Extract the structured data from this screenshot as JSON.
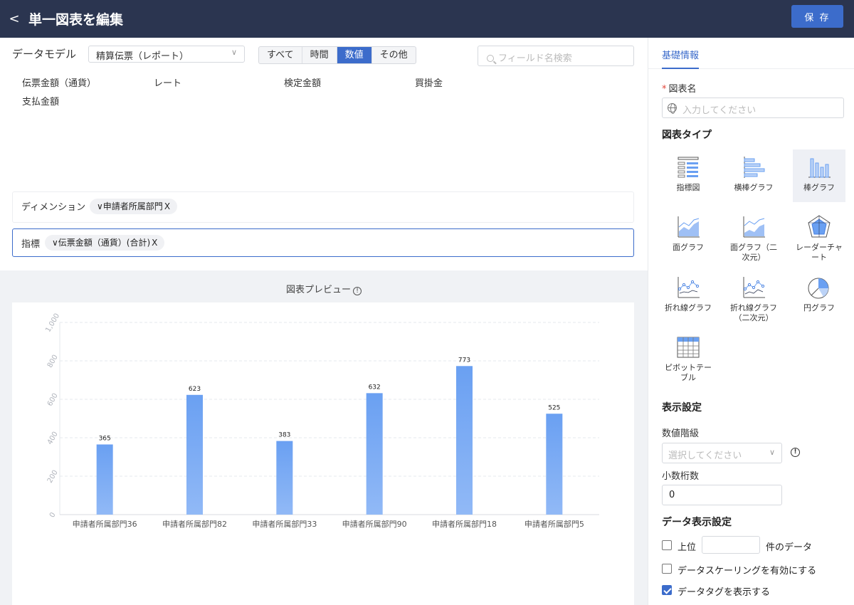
{
  "header": {
    "back_glyph": "<",
    "title": "単一図表を編集",
    "save_label": "保 存"
  },
  "data_model": {
    "label": "データモデル",
    "selected": "精算伝票（レポート）",
    "segments": [
      {
        "label": "すべて",
        "active": false
      },
      {
        "label": "時間",
        "active": false
      },
      {
        "label": "数値",
        "active": true
      },
      {
        "label": "その他",
        "active": false
      }
    ],
    "search_placeholder": "フィールド名検索"
  },
  "fields": [
    "伝票金額（通貨）",
    "レート",
    "検定金額",
    "買掛金",
    "支払金額"
  ],
  "dimension": {
    "label": "ディメンション",
    "chip": "申請者所属部門",
    "chip_prefix": "∨",
    "chip_remove": "X"
  },
  "indicator": {
    "label": "指標",
    "chip": "伝票金額（通貨）(合計)",
    "chip_prefix": "∨",
    "chip_remove": "X"
  },
  "preview": {
    "title": "図表プレビュー"
  },
  "chart_data": {
    "type": "bar",
    "categories": [
      "申請者所属部門36",
      "申請者所属部門82",
      "申請者所属部門33",
      "申請者所属部門90",
      "申請者所属部門18",
      "申請者所属部門5"
    ],
    "values": [
      365,
      623,
      383,
      632,
      773,
      525
    ],
    "data_labels": true,
    "ylim": [
      0,
      1000
    ],
    "yticks": [
      0,
      200,
      400,
      600,
      800,
      1000
    ],
    "ytick_labels": [
      "0",
      "200",
      "400",
      "600",
      "800",
      "1,000"
    ],
    "grid": true,
    "bar_color": "#6aa0f2"
  },
  "right_panel": {
    "tab": "基礎情報",
    "chart_name_label": "図表名",
    "required_mark": "*",
    "chart_name_placeholder": "入力してください",
    "chart_type_title": "図表タイプ",
    "chart_types": [
      {
        "label": "指標図",
        "icon": "indicator-chart-icon",
        "selected": false
      },
      {
        "label": "横棒グラフ",
        "icon": "horizontal-bar-icon",
        "selected": false
      },
      {
        "label": "棒グラフ",
        "icon": "bar-chart-icon",
        "selected": true
      },
      {
        "label": "面グラフ",
        "icon": "area-chart-icon",
        "selected": false
      },
      {
        "label": "面グラフ（二次元）",
        "icon": "area-chart-2d-icon",
        "selected": false
      },
      {
        "label": "レーダーチャート",
        "icon": "radar-chart-icon",
        "selected": false
      },
      {
        "label": "折れ線グラフ",
        "icon": "line-chart-icon",
        "selected": false
      },
      {
        "label": "折れ線グラフ（二次元）",
        "icon": "line-chart-2d-icon",
        "selected": false
      },
      {
        "label": "円グラフ",
        "icon": "pie-chart-icon",
        "selected": false
      },
      {
        "label": "ピボットテーブル",
        "icon": "pivot-table-icon",
        "selected": false
      }
    ],
    "display_settings_title": "表示設定",
    "value_scale_label": "数値階級",
    "value_scale_placeholder": "選択してください",
    "decimal_label": "小数桁数",
    "decimal_value": "0",
    "data_display_title": "データ表示設定",
    "top_n_label": "上位",
    "top_n_suffix": "件のデータ",
    "scaling_label": "データスケーリングを有効にする",
    "scaling_checked": false,
    "top_n_checked": false,
    "show_tags_label": "データタグを表示する",
    "show_tags_checked": true
  }
}
